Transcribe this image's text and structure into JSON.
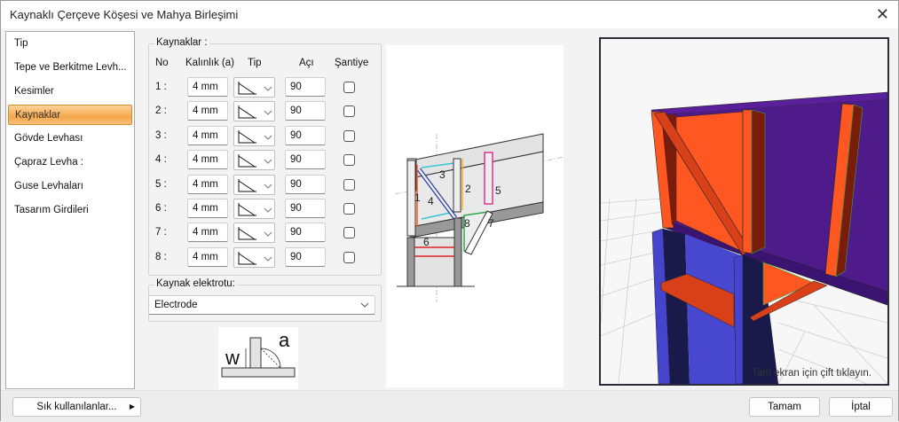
{
  "window": {
    "title": "Kaynaklı Çerçeve Köşesi ve Mahya Birleşimi",
    "close": "✕"
  },
  "sidebar": {
    "items": [
      {
        "label": "Tip"
      },
      {
        "label": "Tepe ve Berkitme Levh..."
      },
      {
        "label": "Kesimler"
      },
      {
        "label": "Kaynaklar",
        "active": true
      },
      {
        "label": "Gövde Levhası"
      },
      {
        "label": "Çapraz Levha :"
      },
      {
        "label": "Guse Levhaları"
      },
      {
        "label": "Tasarım Girdileri"
      }
    ]
  },
  "welds": {
    "group_label": "Kaynaklar :",
    "headers": {
      "no": "No",
      "thickness": "Kalınlık (a)",
      "type": "Tip",
      "angle": "Açı",
      "site": "Şantiye"
    },
    "rows": [
      {
        "no": "1 :",
        "thickness": "4 mm",
        "angle": "90",
        "site": false
      },
      {
        "no": "2 :",
        "thickness": "4 mm",
        "angle": "90",
        "site": false
      },
      {
        "no": "3 :",
        "thickness": "4 mm",
        "angle": "90",
        "site": false
      },
      {
        "no": "4 :",
        "thickness": "4 mm",
        "angle": "90",
        "site": false
      },
      {
        "no": "5 :",
        "thickness": "4 mm",
        "angle": "90",
        "site": false
      },
      {
        "no": "6 :",
        "thickness": "4 mm",
        "angle": "90",
        "site": false
      },
      {
        "no": "7 :",
        "thickness": "4 mm",
        "angle": "90",
        "site": false
      },
      {
        "no": "8 :",
        "thickness": "4 mm",
        "angle": "90",
        "site": false
      }
    ]
  },
  "electrode": {
    "group_label": "Kaynak elektrotu:",
    "value": "Electrode"
  },
  "weld_sketch": {
    "w": "w",
    "a": "a"
  },
  "diagram_labels": [
    "1",
    "2",
    "3",
    "4",
    "5",
    "6",
    "7",
    "8"
  ],
  "view3d": {
    "hint": "Tam ekran için çift tıklayın."
  },
  "footer": {
    "favorites": "Sık kullanılanlar...",
    "ok": "Tamam",
    "cancel": "İptal"
  },
  "colors": {
    "accent": "#f5a74a",
    "beam": "#4f1a8a",
    "plate": "#ff5722",
    "column": "#4444cc"
  }
}
